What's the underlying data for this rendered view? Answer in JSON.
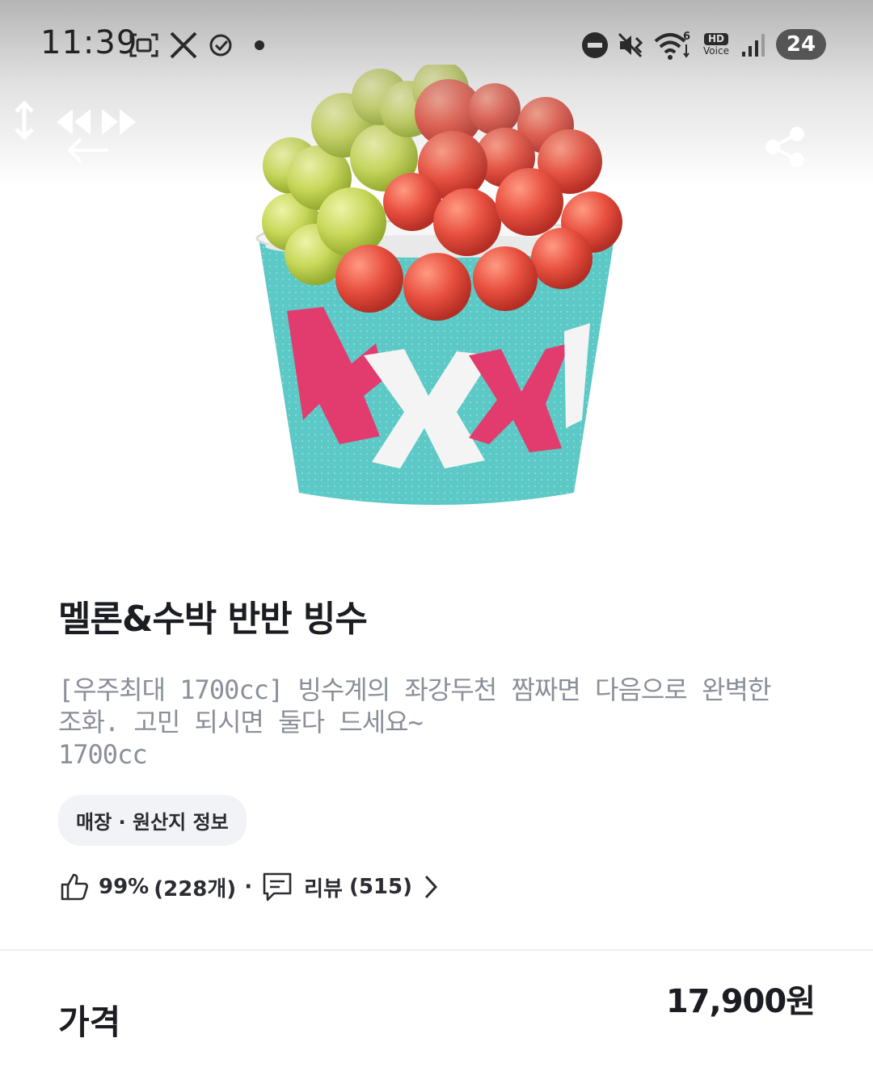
{
  "status_bar": {
    "time": "11:39",
    "left_icons": [
      "screenshot-icon",
      "x-app-icon",
      "check-circle-icon",
      "dot-icon"
    ],
    "right_icons": [
      "do-not-disturb-icon",
      "mute-vibrate-icon",
      "wifi-6-icon",
      "hd-voice-icon",
      "signal-icon"
    ],
    "wifi_badge": "6",
    "hd_voice": {
      "top": "HD",
      "bottom": "Voice"
    },
    "battery": "24"
  },
  "overlay": {
    "icons": [
      "vertical-resize-icon",
      "rewind-icon",
      "fast-forward-icon",
      "back-arrow-icon",
      "share-icon"
    ]
  },
  "product": {
    "image_icon": "melon-watermelon-bingsu-cup-image",
    "title": "멜론&수박 반반 빙수",
    "description_line1": "[우주최대 1700cc] 빙수계의 좌강두천 짬짜면 다음으로 완벽한",
    "description_line2": "조화. 고민 되시면 둘다 드세요~",
    "description_line3": "1700cc",
    "origin_label": "매장 · 원산지 정보",
    "rating_percent": "99%",
    "rating_count": "(228개)",
    "separator": "·",
    "review_label": "리뷰",
    "review_count": "(515)"
  },
  "price": {
    "label": "가격",
    "value": "17,900원"
  },
  "colors": {
    "melon": "#c8d85a",
    "watermelon": "#e8503f",
    "cup_teal": "#5cc9c6",
    "cup_pink": "#e23c6e",
    "text_gray": "#8a8f99"
  }
}
